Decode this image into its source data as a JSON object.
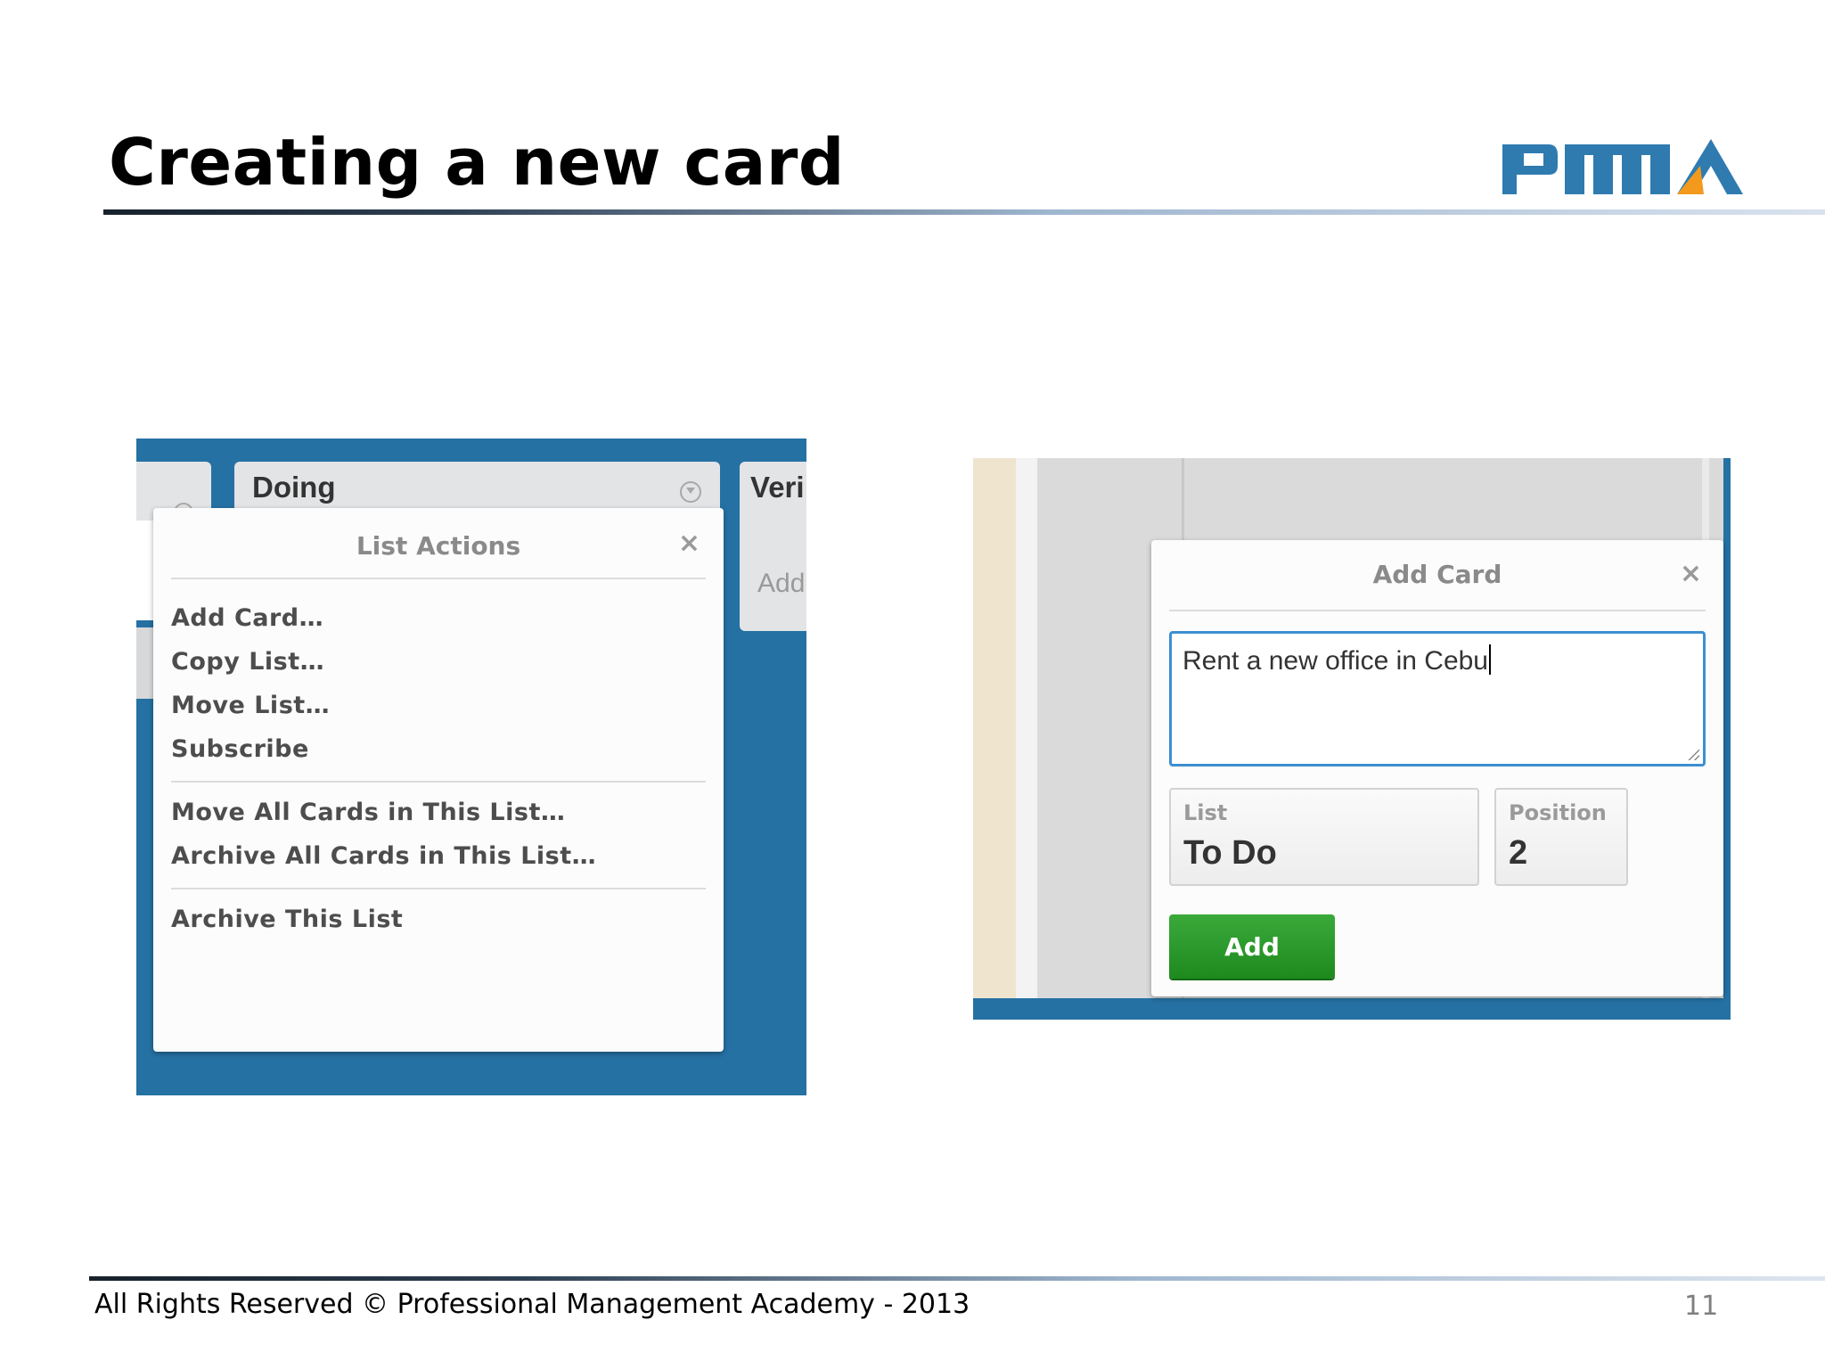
{
  "slide": {
    "title": "Creating a new card",
    "footer": "All Rights Reserved © Professional Management Academy - 2013",
    "page_number": "11",
    "logo_icon": "pma-logo-icon",
    "colors": {
      "logo_blue": "#2f7bb0",
      "logo_orange": "#f39a1d",
      "board_blue": "#2571a3",
      "add_green": "#2a9a2a"
    }
  },
  "left_screenshot": {
    "lists": {
      "doing_title": "Doing",
      "next_title": "Veri",
      "next_add": "Add"
    },
    "list_actions": {
      "title": "List Actions",
      "close": "×",
      "group1": [
        "Add Card…",
        "Copy List…",
        "Move List…",
        "Subscribe"
      ],
      "group2": [
        "Move All Cards in This List…",
        "Archive All Cards in This List…"
      ],
      "group3": [
        "Archive This List"
      ]
    }
  },
  "right_screenshot": {
    "add_card": {
      "title": "Add Card",
      "close": "×",
      "card_title_value": "Rent a new office in Cebu",
      "list_label": "List",
      "list_value": "To Do",
      "position_label": "Position",
      "position_value": "2",
      "add_button": "Add"
    }
  }
}
